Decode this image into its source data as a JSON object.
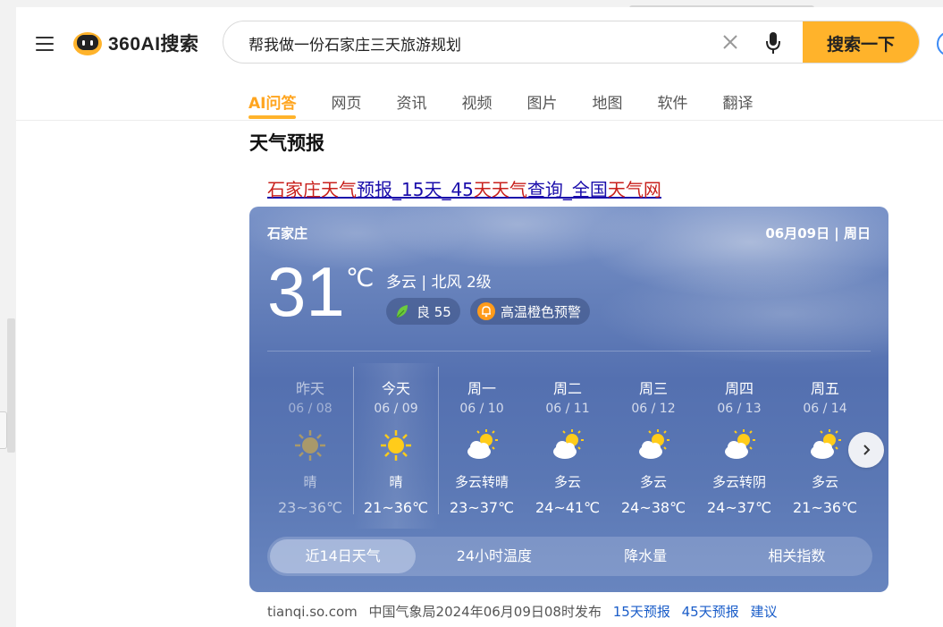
{
  "header": {
    "logo_text": "360AI搜索",
    "search_query": "帮我做一份石家庄三天旅游规划",
    "search_button": "搜索一下",
    "tabs": [
      "AI问答",
      "网页",
      "资讯",
      "视频",
      "图片",
      "地图",
      "软件",
      "翻译"
    ],
    "active_tab": "AI问答"
  },
  "section": {
    "title": "天气预报",
    "link_parts": [
      "石家庄天气",
      "预报_15天_45",
      "天天气",
      "查询_全国",
      "天气网"
    ]
  },
  "weather": {
    "city": "石家庄",
    "date": "06月09日 | 周日",
    "temp": "31",
    "unit": "℃",
    "condition": "多云 | 北风 2级",
    "aqi": "良 55",
    "warning": "高温橙色预警",
    "days": [
      {
        "name": "昨天",
        "date": "06 / 08",
        "icon": "sun-icon",
        "cond": "晴",
        "temp": "23~36℃"
      },
      {
        "name": "今天",
        "date": "06 / 09",
        "icon": "sun-icon",
        "cond": "晴",
        "temp": "21~36℃"
      },
      {
        "name": "周一",
        "date": "06 / 10",
        "icon": "partly-cloudy-icon",
        "cond": "多云转晴",
        "temp": "23~37℃"
      },
      {
        "name": "周二",
        "date": "06 / 11",
        "icon": "partly-cloudy-icon",
        "cond": "多云",
        "temp": "24~41℃"
      },
      {
        "name": "周三",
        "date": "06 / 12",
        "icon": "partly-cloudy-icon",
        "cond": "多云",
        "temp": "24~38℃"
      },
      {
        "name": "周四",
        "date": "06 / 13",
        "icon": "partly-cloudy-icon",
        "cond": "多云转阴",
        "temp": "24~37℃"
      },
      {
        "name": "周五",
        "date": "06 / 14",
        "icon": "partly-cloudy-icon",
        "cond": "多云",
        "temp": "21~36℃"
      }
    ],
    "bottom_tabs": [
      "近14日天气",
      "24小时温度",
      "降水量",
      "相关指数"
    ],
    "active_bottom_tab": "近14日天气"
  },
  "footer": {
    "source": "tianqi.so.com",
    "publish": "中国气象局2024年06月09日08时发布",
    "links": [
      "15天预报",
      "45天预报",
      "建议"
    ]
  },
  "colors": {
    "accent": "#ffb32b",
    "link": "#1a0dab",
    "highlight": "#c8201c",
    "card": "#5a77b4"
  }
}
